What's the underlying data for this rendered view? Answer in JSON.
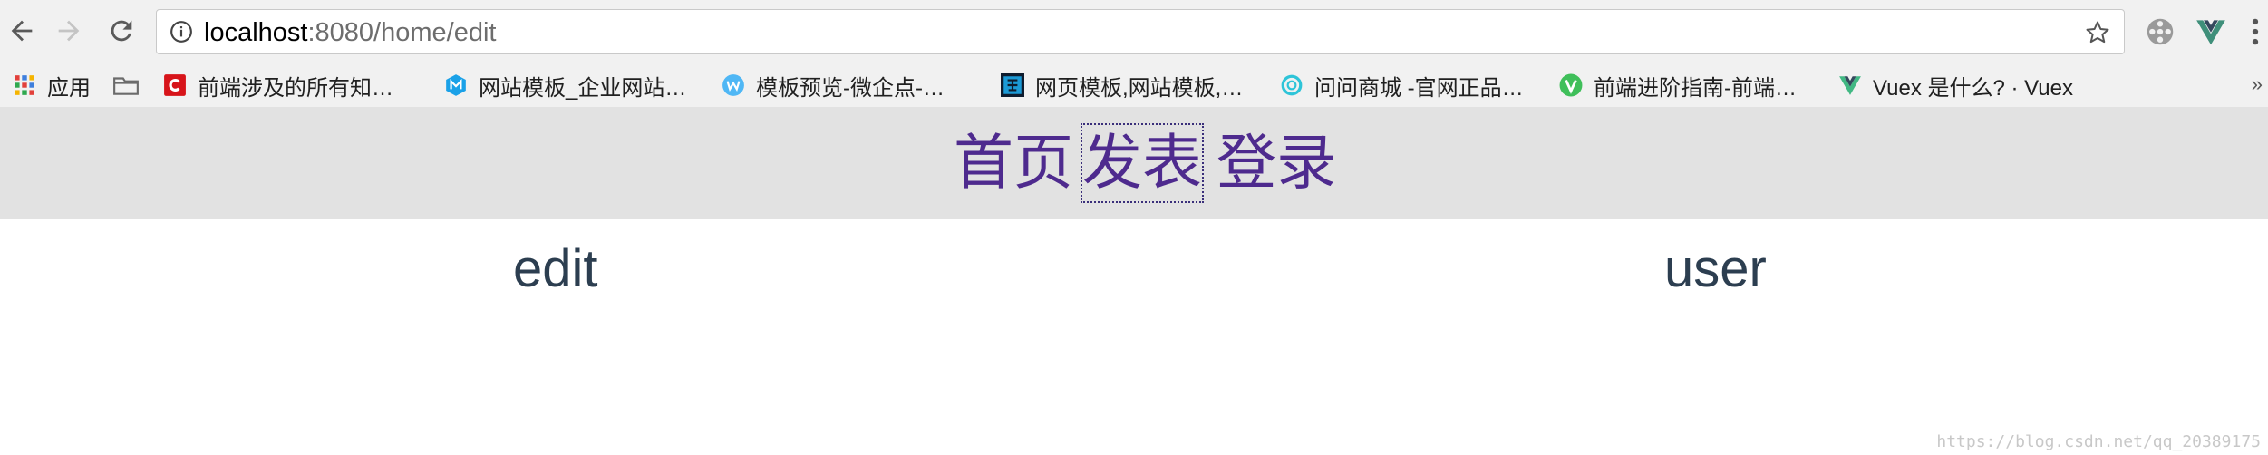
{
  "browser": {
    "url_host": "localhost",
    "url_rest": ":8080/home/edit",
    "icons": {
      "back": "arrow-left-icon",
      "forward": "arrow-right-icon",
      "reload": "reload-icon",
      "info": "info-icon",
      "bookmark_star": "star-icon",
      "extensions": [
        "film-reel-icon",
        "vue-devtools-icon"
      ],
      "menu": "more-vert-icon"
    }
  },
  "bookmarks": {
    "items": [
      {
        "label": "应用",
        "icon": "apps-grid-icon"
      },
      {
        "label": "",
        "icon": "folder-icon"
      },
      {
        "label": "前端涉及的所有知…",
        "icon": "site-c-icon"
      },
      {
        "label": "网站模板_企业网站…",
        "icon": "site-m-icon"
      },
      {
        "label": "模板预览-微企点-…",
        "icon": "site-w-icon"
      },
      {
        "label": "网页模板,网站模板,…",
        "icon": "site-mo-icon"
      },
      {
        "label": "问问商城 -官网正品…",
        "icon": "site-ring-icon"
      },
      {
        "label": "前端进阶指南-前端…",
        "icon": "site-v-icon"
      },
      {
        "label": "Vuex 是什么? · Vuex",
        "icon": "vue-logo-icon"
      }
    ],
    "more": "»"
  },
  "app_nav": {
    "links": [
      "首页",
      "发表",
      "登录"
    ],
    "focused_index": 1
  },
  "content": {
    "left": "edit",
    "right": "user"
  },
  "watermark": "https://blog.csdn.net/qq_20389175",
  "colors": {
    "nav_link": "#4e2a8e",
    "content_text": "#2c3e50",
    "nav_bg": "#e2e2e2"
  }
}
